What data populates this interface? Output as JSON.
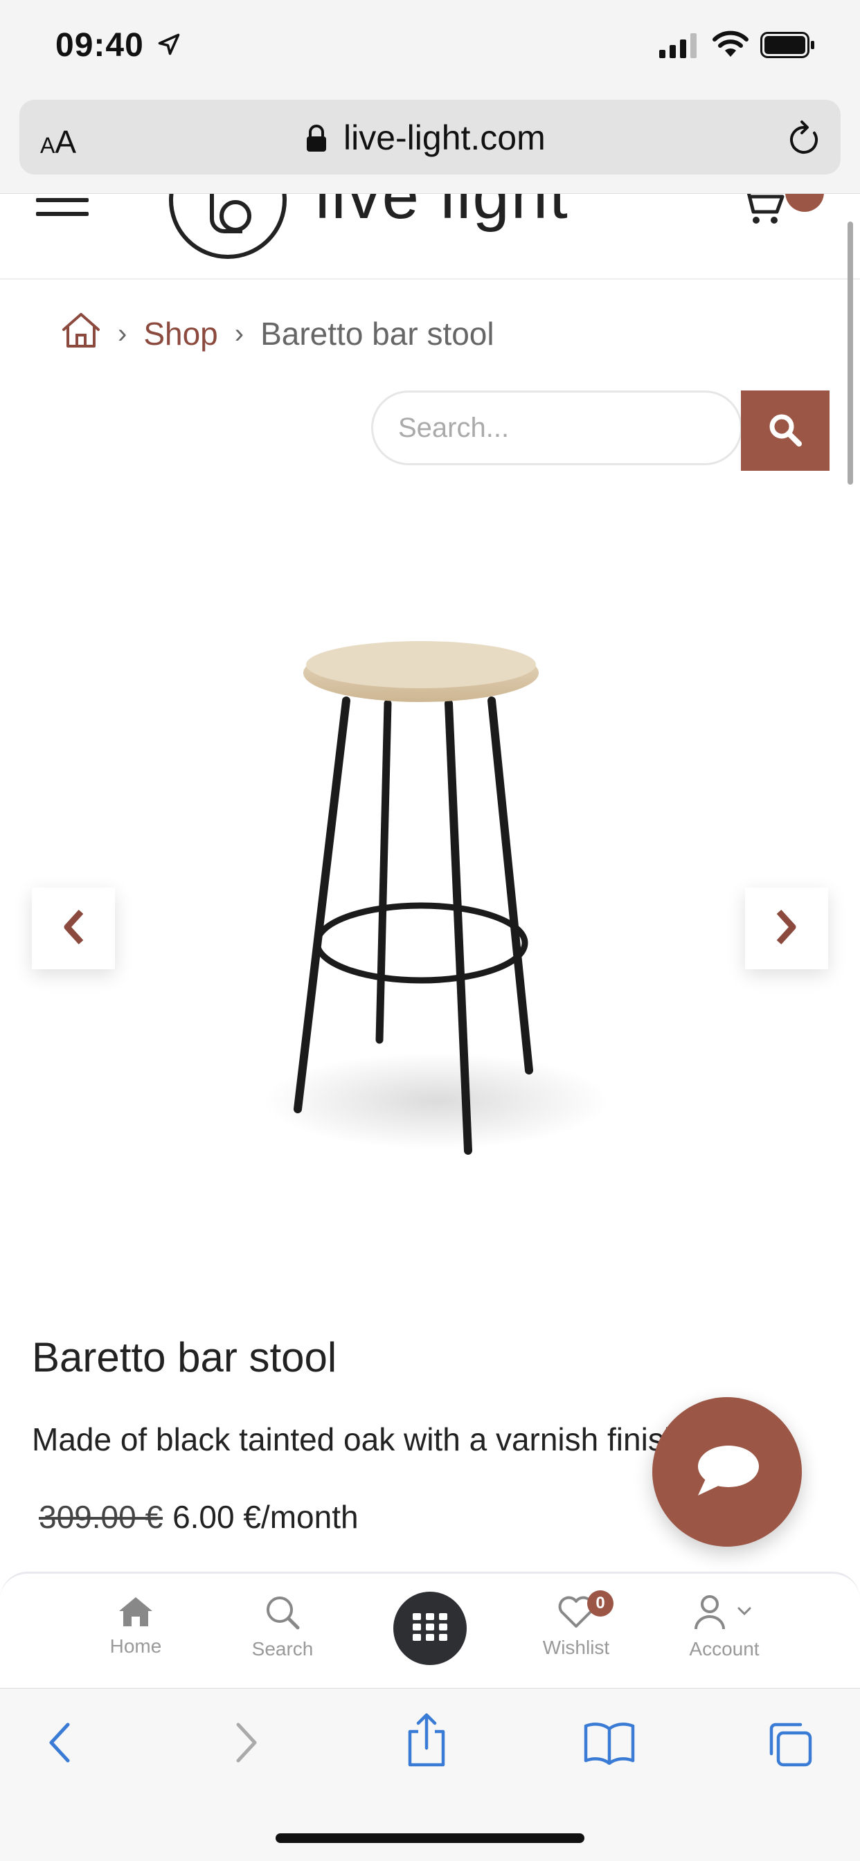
{
  "status_bar": {
    "time": "09:40"
  },
  "browser": {
    "text_size_label": "AA",
    "domain": "live-light.com"
  },
  "site": {
    "logo_text": "live light"
  },
  "breadcrumb": {
    "shop": "Shop",
    "current": "Baretto bar stool"
  },
  "search": {
    "placeholder": "Search..."
  },
  "product": {
    "title": "Baretto bar stool",
    "description": "Made of black tainted oak with a varnish finish",
    "old_price": "309.00 €",
    "price": "6.00 €/month"
  },
  "bottom_nav": {
    "home": "Home",
    "search": "Search",
    "wishlist": "Wishlist",
    "wishlist_count": "0",
    "account": "Account"
  },
  "colors": {
    "accent": "#9c5646",
    "dark": "#2d2f33",
    "safari_blue": "#3a7bd5"
  }
}
